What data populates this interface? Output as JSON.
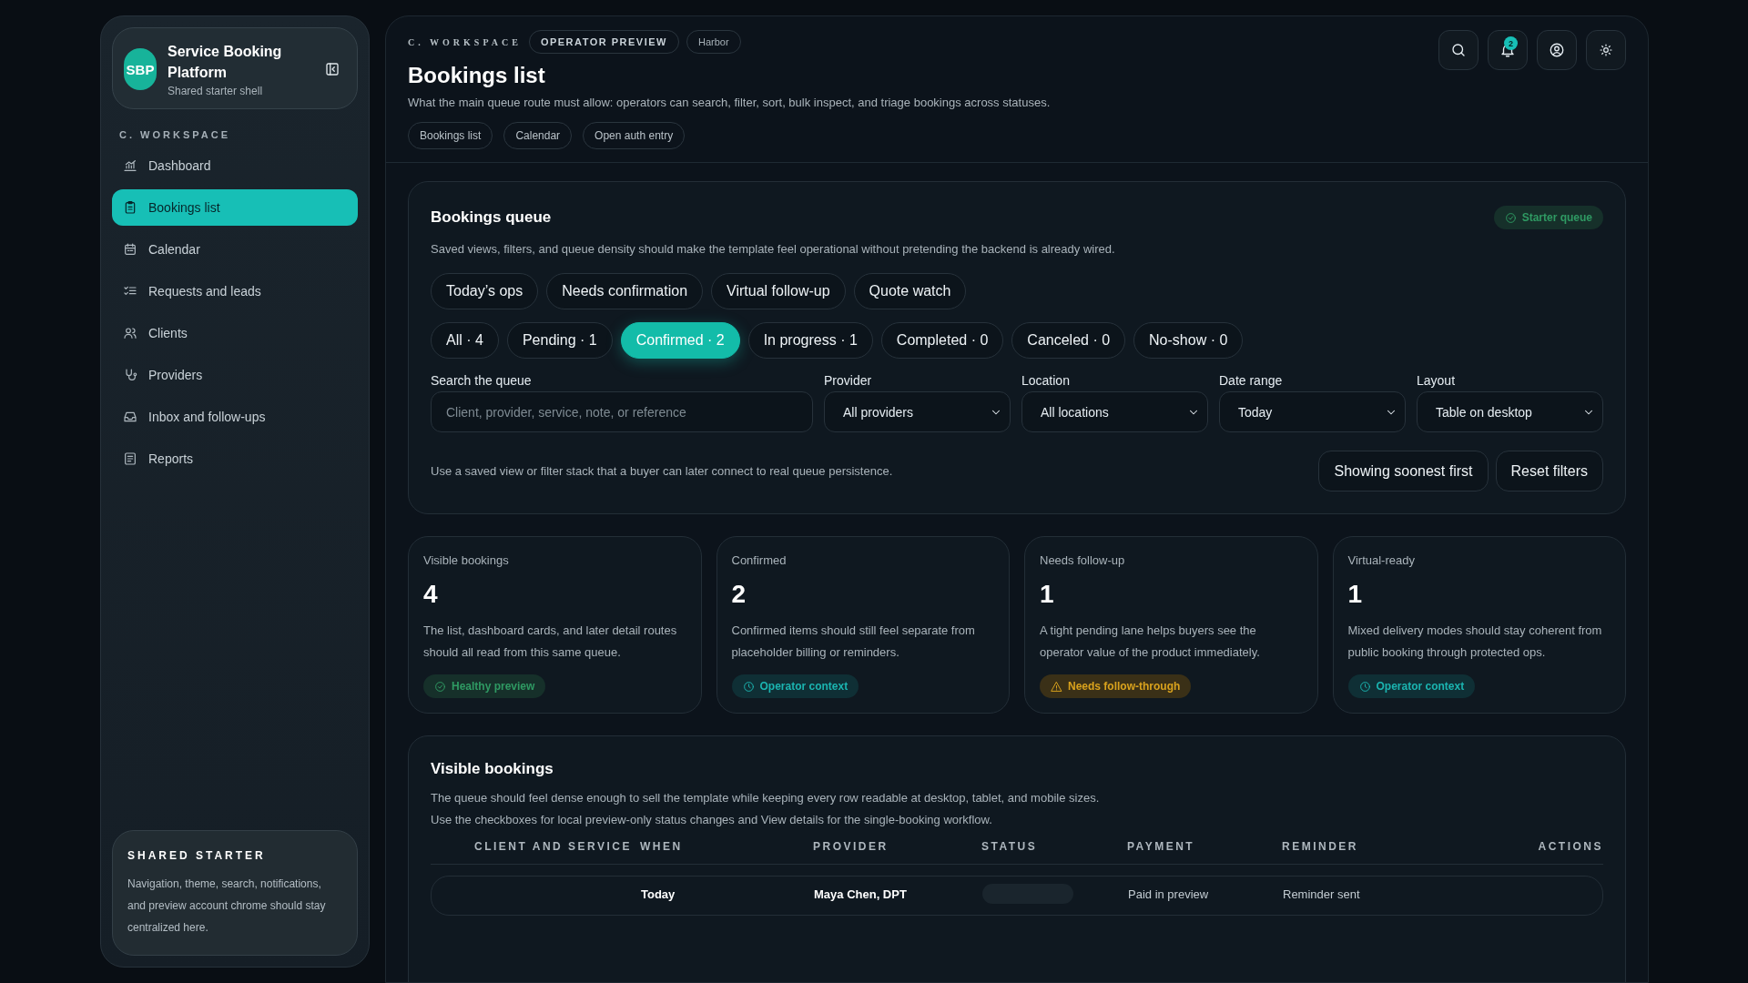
{
  "sidebar": {
    "brand": {
      "initials": "SBP",
      "title": "Service Booking Platform",
      "subtitle": "Shared starter shell"
    },
    "section_label": "C. WORKSPACE",
    "items": [
      {
        "label": "Dashboard",
        "selected": false
      },
      {
        "label": "Bookings list",
        "selected": true
      },
      {
        "label": "Calendar",
        "selected": false
      },
      {
        "label": "Requests and leads",
        "selected": false
      },
      {
        "label": "Clients",
        "selected": false
      },
      {
        "label": "Providers",
        "selected": false
      },
      {
        "label": "Inbox and follow-ups",
        "selected": false
      },
      {
        "label": "Reports",
        "selected": false
      }
    ],
    "footer": {
      "title": "SHARED STARTER",
      "text": "Navigation, theme, search, notifications, and preview account chrome should stay centralized here."
    }
  },
  "header": {
    "eyebrow": "C. WORKSPACE",
    "badges": [
      "OPERATOR PREVIEW",
      "Harbor"
    ],
    "title": "Bookings list",
    "description": "What the main queue route must allow: operators can search, filter, sort, bulk inspect, and triage bookings across statuses.",
    "links": [
      "Bookings list",
      "Calendar",
      "Open auth entry"
    ],
    "notification_count": "2"
  },
  "queue": {
    "title": "Bookings queue",
    "badge": "Starter queue",
    "description": "Saved views, filters, and queue density should make the template feel operational without pretending the backend is already wired.",
    "saved_views": [
      "Today’s ops",
      "Needs confirmation",
      "Virtual follow-up",
      "Quote watch"
    ],
    "status_filters": [
      {
        "label": "All · 4",
        "selected": false
      },
      {
        "label": "Pending · 1",
        "selected": false
      },
      {
        "label": "Confirmed · 2",
        "selected": true
      },
      {
        "label": "In progress · 1",
        "selected": false
      },
      {
        "label": "Completed · 0",
        "selected": false
      },
      {
        "label": "Canceled · 0",
        "selected": false
      },
      {
        "label": "No-show · 0",
        "selected": false
      }
    ],
    "search": {
      "label": "Search the queue",
      "placeholder": "Client, provider, service, note, or reference"
    },
    "selects": [
      {
        "label": "Provider",
        "value": "All providers"
      },
      {
        "label": "Location",
        "value": "All locations"
      },
      {
        "label": "Date range",
        "value": "Today"
      },
      {
        "label": "Layout",
        "value": "Table on desktop"
      }
    ],
    "note": "Use a saved view or filter stack that a buyer can later connect to real queue persistence.",
    "buttons": [
      "Showing soonest first",
      "Reset filters"
    ]
  },
  "stats": [
    {
      "label": "Visible bookings",
      "value": "4",
      "text": "The list, dashboard cards, and later detail routes should all read from this same queue.",
      "badge": "Healthy preview",
      "kind": "success"
    },
    {
      "label": "Confirmed",
      "value": "2",
      "text": "Confirmed items should still feel separate from placeholder billing or reminders.",
      "badge": "Operator context",
      "kind": "info"
    },
    {
      "label": "Needs follow-up",
      "value": "1",
      "text": "A tight pending lane helps buyers see the operator value of the product immediately.",
      "badge": "Needs follow-through",
      "kind": "warning"
    },
    {
      "label": "Virtual-ready",
      "value": "1",
      "text": "Mixed delivery modes should stay coherent from public booking through protected ops.",
      "badge": "Operator context",
      "kind": "info"
    }
  ],
  "table": {
    "title": "Visible bookings",
    "description": "The queue should feel dense enough to sell the template while keeping every row readable at desktop, tablet, and mobile sizes. Use the checkboxes for local preview-only status changes and View details for the single-booking workflow.",
    "columns": [
      "CLIENT AND SERVICE",
      "WHEN",
      "PROVIDER",
      "STATUS",
      "PAYMENT",
      "REMINDER",
      "ACTIONS"
    ],
    "rows": [
      {
        "when": "Today",
        "provider": "Maya Chen, DPT",
        "payment": "Paid in preview",
        "reminder": "Reminder sent"
      }
    ]
  }
}
